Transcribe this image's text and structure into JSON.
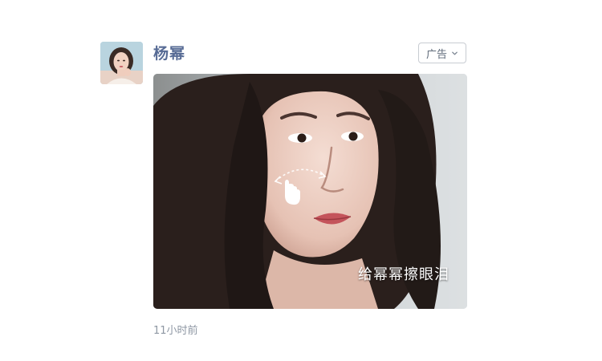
{
  "post": {
    "author_name": "杨幂",
    "ad_label": "广告",
    "overlay_caption": "给幂幂擦眼泪",
    "timestamp": "11小时前"
  },
  "icons": {
    "ad_menu": "chevron-down-icon",
    "gesture": "hand-swipe-icon"
  },
  "colors": {
    "author_name": "#576b95",
    "timestamp": "#8e97a3",
    "dropdown_border": "#c8ccd2"
  }
}
